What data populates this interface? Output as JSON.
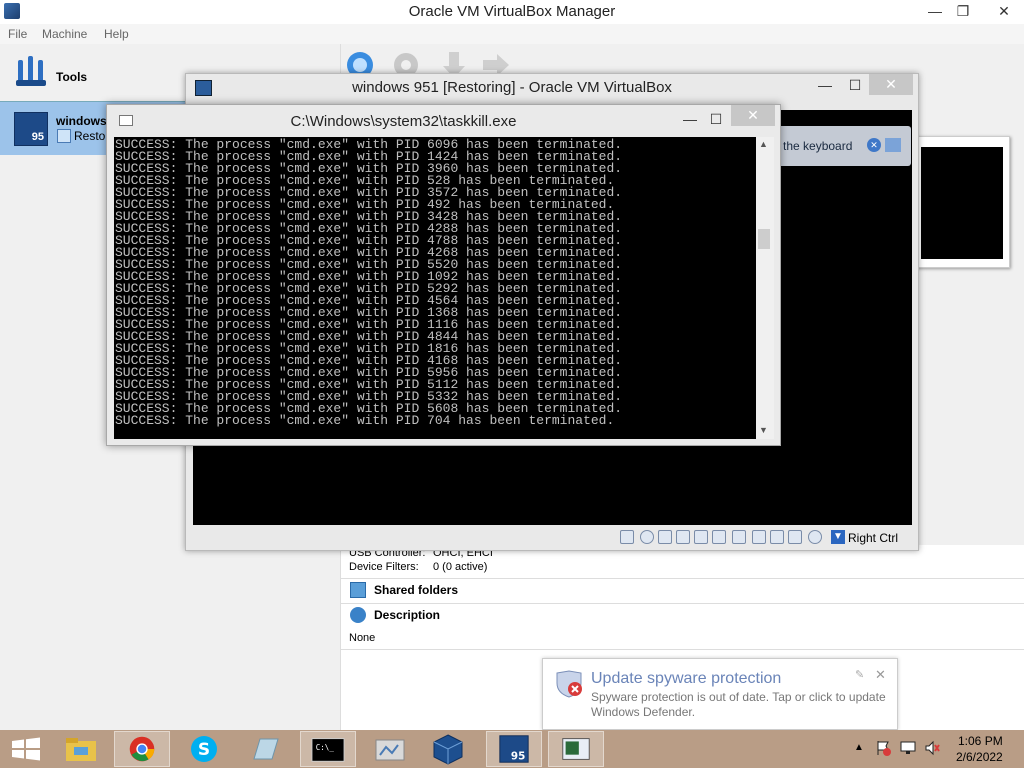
{
  "manager": {
    "title": "Oracle VM VirtualBox Manager",
    "menu": [
      "File",
      "Machine",
      "Help"
    ],
    "tools_label": "Tools",
    "vm_name": "windows",
    "vm_state": "Resto",
    "vm_badge": "95",
    "details": {
      "usb_controller_label": "USB Controller:",
      "usb_controller_value": "OHCI, EHCI",
      "device_filters_label": "Device Filters:",
      "device_filters_value": "0 (0 active)",
      "shared_folders": "Shared folders",
      "description": "Description",
      "description_value": "None"
    }
  },
  "vm_window": {
    "title": "windows 951 [Restoring] - Oracle VM VirtualBox",
    "notification": "the keyboard",
    "host_key": "Right Ctrl"
  },
  "console": {
    "title": "C:\\Windows\\system32\\taskkill.exe",
    "lines": [
      "SUCCESS: The process \"cmd.exe\" with PID 6096 has been terminated.",
      "SUCCESS: The process \"cmd.exe\" with PID 1424 has been terminated.",
      "SUCCESS: The process \"cmd.exe\" with PID 3960 has been terminated.",
      "SUCCESS: The process \"cmd.exe\" with PID 528 has been terminated.",
      "SUCCESS: The process \"cmd.exe\" with PID 3572 has been terminated.",
      "SUCCESS: The process \"cmd.exe\" with PID 492 has been terminated.",
      "SUCCESS: The process \"cmd.exe\" with PID 3428 has been terminated.",
      "SUCCESS: The process \"cmd.exe\" with PID 4288 has been terminated.",
      "SUCCESS: The process \"cmd.exe\" with PID 4788 has been terminated.",
      "SUCCESS: The process \"cmd.exe\" with PID 4268 has been terminated.",
      "SUCCESS: The process \"cmd.exe\" with PID 5520 has been terminated.",
      "SUCCESS: The process \"cmd.exe\" with PID 1092 has been terminated.",
      "SUCCESS: The process \"cmd.exe\" with PID 5292 has been terminated.",
      "SUCCESS: The process \"cmd.exe\" with PID 4564 has been terminated.",
      "SUCCESS: The process \"cmd.exe\" with PID 1368 has been terminated.",
      "SUCCESS: The process \"cmd.exe\" with PID 1116 has been terminated.",
      "SUCCESS: The process \"cmd.exe\" with PID 4844 has been terminated.",
      "SUCCESS: The process \"cmd.exe\" with PID 1816 has been terminated.",
      "SUCCESS: The process \"cmd.exe\" with PID 4168 has been terminated.",
      "SUCCESS: The process \"cmd.exe\" with PID 5956 has been terminated.",
      "SUCCESS: The process \"cmd.exe\" with PID 5112 has been terminated.",
      "SUCCESS: The process \"cmd.exe\" with PID 5332 has been terminated.",
      "SUCCESS: The process \"cmd.exe\" with PID 5608 has been terminated.",
      "SUCCESS: The process \"cmd.exe\" with PID 704 has been terminated."
    ]
  },
  "toast": {
    "title": "Update spyware protection",
    "body": "Spyware protection is out of date. Tap or click to update Windows Defender."
  },
  "taskbar": {
    "apps": [
      "start-icon",
      "file-explorer-icon",
      "chrome-icon",
      "skype-icon",
      "notepad-icon",
      "cmd-icon",
      "screenshot-icon",
      "virtualbox-icon",
      "windows95-vm-icon",
      "defender-icon"
    ],
    "clock_time": "1:06 PM",
    "clock_date": "2/6/2022",
    "color": "#b99d86"
  }
}
